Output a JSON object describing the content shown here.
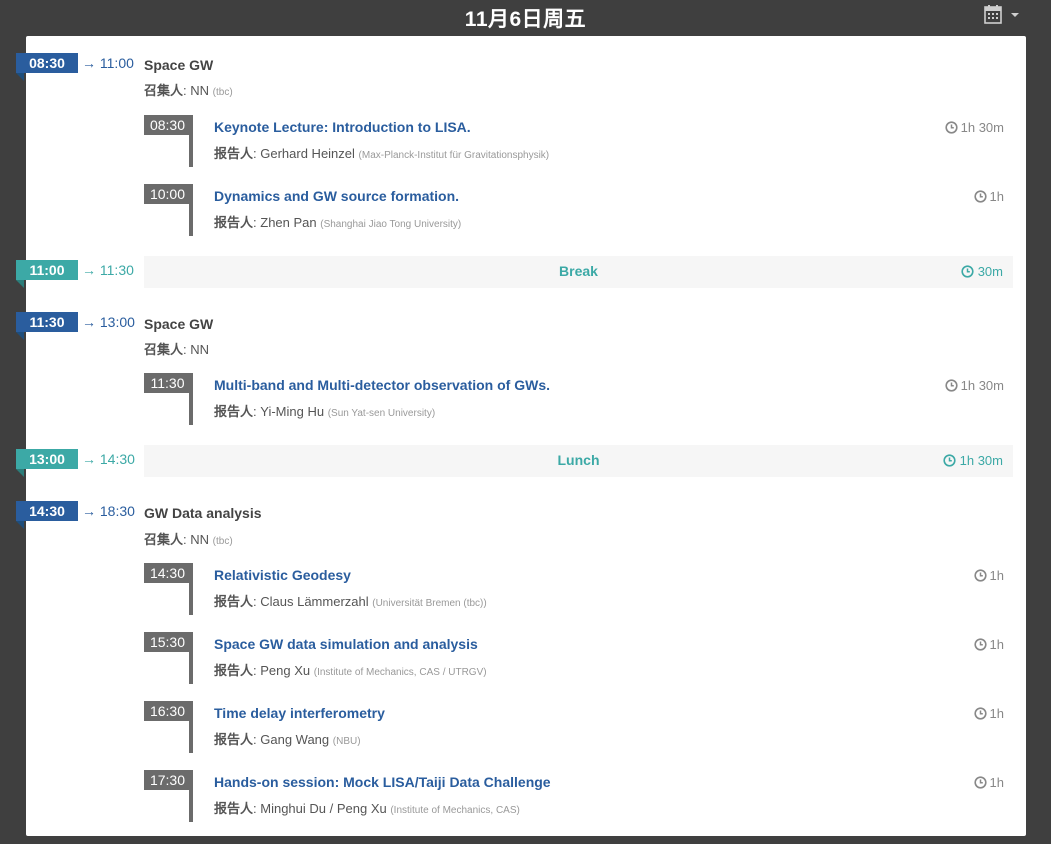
{
  "header": {
    "date_title": "11月6日周五",
    "calendar_icon": "calendar-icon",
    "dropdown_icon": "caret-down-icon"
  },
  "labels": {
    "convener": "召集人",
    "speaker": "报告人"
  },
  "sessions": [
    {
      "start": "08:30",
      "end": "→ 11:00",
      "title": "Space GW",
      "convener": "NN",
      "convener_note": "(tbc)",
      "contributions": [
        {
          "time": "08:30",
          "title": "Keynote Lecture: Introduction to LISA.",
          "speaker": "Gerhard Heinzel",
          "affiliation": "(Max-Planck-Institut für Gravitationsphysik)",
          "duration": "1h 30m"
        },
        {
          "time": "10:00",
          "title": "Dynamics and GW source formation.",
          "speaker": "Zhen Pan",
          "affiliation": "(Shanghai Jiao Tong University)",
          "duration": "1h"
        }
      ]
    },
    {
      "start": "11:30",
      "end": "→ 13:00",
      "title": "Space GW",
      "convener": "NN",
      "convener_note": "",
      "contributions": [
        {
          "time": "11:30",
          "title": "Multi-band and Multi-detector observation of GWs.",
          "speaker": "Yi-Ming Hu",
          "affiliation": "(Sun Yat-sen University)",
          "duration": "1h 30m"
        }
      ]
    },
    {
      "start": "14:30",
      "end": "→ 18:30",
      "title": "GW Data analysis",
      "convener": "NN",
      "convener_note": "(tbc)",
      "contributions": [
        {
          "time": "14:30",
          "title": "Relativistic Geodesy",
          "speaker": "Claus Lämmerzahl",
          "affiliation": "(Universität Bremen (tbc))",
          "duration": "1h"
        },
        {
          "time": "15:30",
          "title": "Space GW data simulation and analysis",
          "speaker": "Peng Xu",
          "affiliation": "(Institute of Mechanics, CAS / UTRGV)",
          "duration": "1h"
        },
        {
          "time": "16:30",
          "title": "Time delay interferometry",
          "speaker": "Gang Wang",
          "affiliation": "(NBU)",
          "duration": "1h"
        },
        {
          "time": "17:30",
          "title": "Hands-on session: Mock LISA/Taiji Data Challenge",
          "speaker": "Minghui Du / Peng Xu",
          "affiliation": "(Institute of Mechanics, CAS)",
          "duration": "1h"
        }
      ]
    }
  ],
  "breaks": [
    {
      "start": "11:00",
      "end": "→ 11:30",
      "title": "Break",
      "duration": "30m"
    },
    {
      "start": "13:00",
      "end": "→ 14:30",
      "title": "Lunch",
      "duration": "1h 30m"
    }
  ],
  "colors": {
    "session_blue": "#2a5d9e",
    "break_teal": "#3ca9a6",
    "contrib_gray": "#6b6b6b"
  }
}
